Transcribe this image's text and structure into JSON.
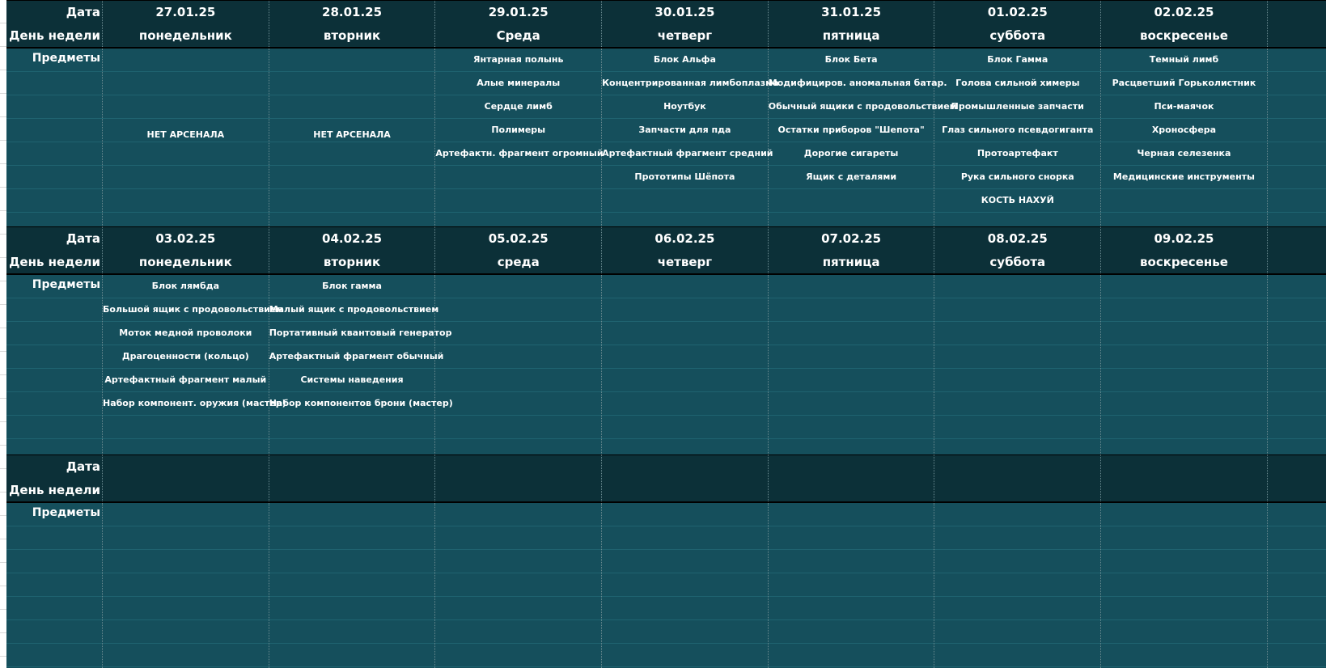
{
  "labels": {
    "date": "Дата",
    "weekday": "День недели",
    "items": "Предметы"
  },
  "weeks": [
    {
      "days": [
        {
          "date": "27.01.25",
          "weekday": "понедельник",
          "note": "НЕТ АРСЕНАЛА",
          "items": []
        },
        {
          "date": "28.01.25",
          "weekday": "вторник",
          "note": "НЕТ АРСЕНАЛА",
          "items": []
        },
        {
          "date": "29.01.25",
          "weekday": "Среда",
          "note": "",
          "items": [
            "Янтарная полынь",
            "Алые минералы",
            "Сердце лимб",
            "Полимеры",
            "Артефактн. фрагмент огромный"
          ]
        },
        {
          "date": "30.01.25",
          "weekday": "четверг",
          "note": "",
          "items": [
            "Блок Альфа",
            "Концентрированная лимбоплазма",
            "Ноутбук",
            "Запчасти для пда",
            "Артефактный фрагмент средний",
            "Прототипы Шёпота"
          ]
        },
        {
          "date": "31.01.25",
          "weekday": "пятница",
          "note": "",
          "items": [
            "Блок Бета",
            "Модифициров. аномальная батар.",
            "Обычный ящики с продовольствием",
            "Остатки приборов \"Шепота\"",
            "Дорогие сигареты",
            "Ящик с деталями"
          ]
        },
        {
          "date": "01.02.25",
          "weekday": "суббота",
          "note": "",
          "items": [
            "Блок Гамма",
            "Голова сильной химеры",
            "Промышленные запчасти",
            "Глаз сильного псевдогиганта",
            "Протоартефакт",
            "Рука сильного снорка",
            "КОСТЬ НАХУЙ"
          ]
        },
        {
          "date": "02.02.25",
          "weekday": "воскресенье",
          "note": "",
          "items": [
            "Темный лимб",
            "Расцветший Горьколистник",
            "Пси-маячок",
            "Хроносфера",
            "Черная селезенка",
            "Медицинские инструменты"
          ]
        }
      ]
    },
    {
      "days": [
        {
          "date": "03.02.25",
          "weekday": "понедельник",
          "note": "",
          "items": [
            "Блок лямбда",
            "Большой ящик с продовольствием",
            "Моток медной проволоки",
            "Драгоценности (кольцо)",
            "Артефактный фрагмент малый",
            "Набор компонент. оружия (мастер)"
          ]
        },
        {
          "date": "04.02.25",
          "weekday": "вторник",
          "note": "",
          "items": [
            "Блок гамма",
            "Малый ящик с продовольствием",
            "Портативный квантовый генератор",
            "Артефактный фрагмент обычный",
            "Системы наведения",
            "Набор компонентов брони (мастер)"
          ]
        },
        {
          "date": "05.02.25",
          "weekday": "среда",
          "note": "",
          "items": []
        },
        {
          "date": "06.02.25",
          "weekday": "четверг",
          "note": "",
          "items": []
        },
        {
          "date": "07.02.25",
          "weekday": "пятница",
          "note": "",
          "items": []
        },
        {
          "date": "08.02.25",
          "weekday": "суббота",
          "note": "",
          "items": []
        },
        {
          "date": "09.02.25",
          "weekday": "воскресенье",
          "note": "",
          "items": []
        }
      ]
    },
    {
      "days": [
        {
          "date": "",
          "weekday": "",
          "note": "",
          "items": []
        },
        {
          "date": "",
          "weekday": "",
          "note": "",
          "items": []
        },
        {
          "date": "",
          "weekday": "",
          "note": "",
          "items": []
        },
        {
          "date": "",
          "weekday": "",
          "note": "",
          "items": []
        },
        {
          "date": "",
          "weekday": "",
          "note": "",
          "items": []
        },
        {
          "date": "",
          "weekday": "",
          "note": "",
          "items": []
        },
        {
          "date": "",
          "weekday": "",
          "note": "",
          "items": []
        }
      ]
    }
  ]
}
